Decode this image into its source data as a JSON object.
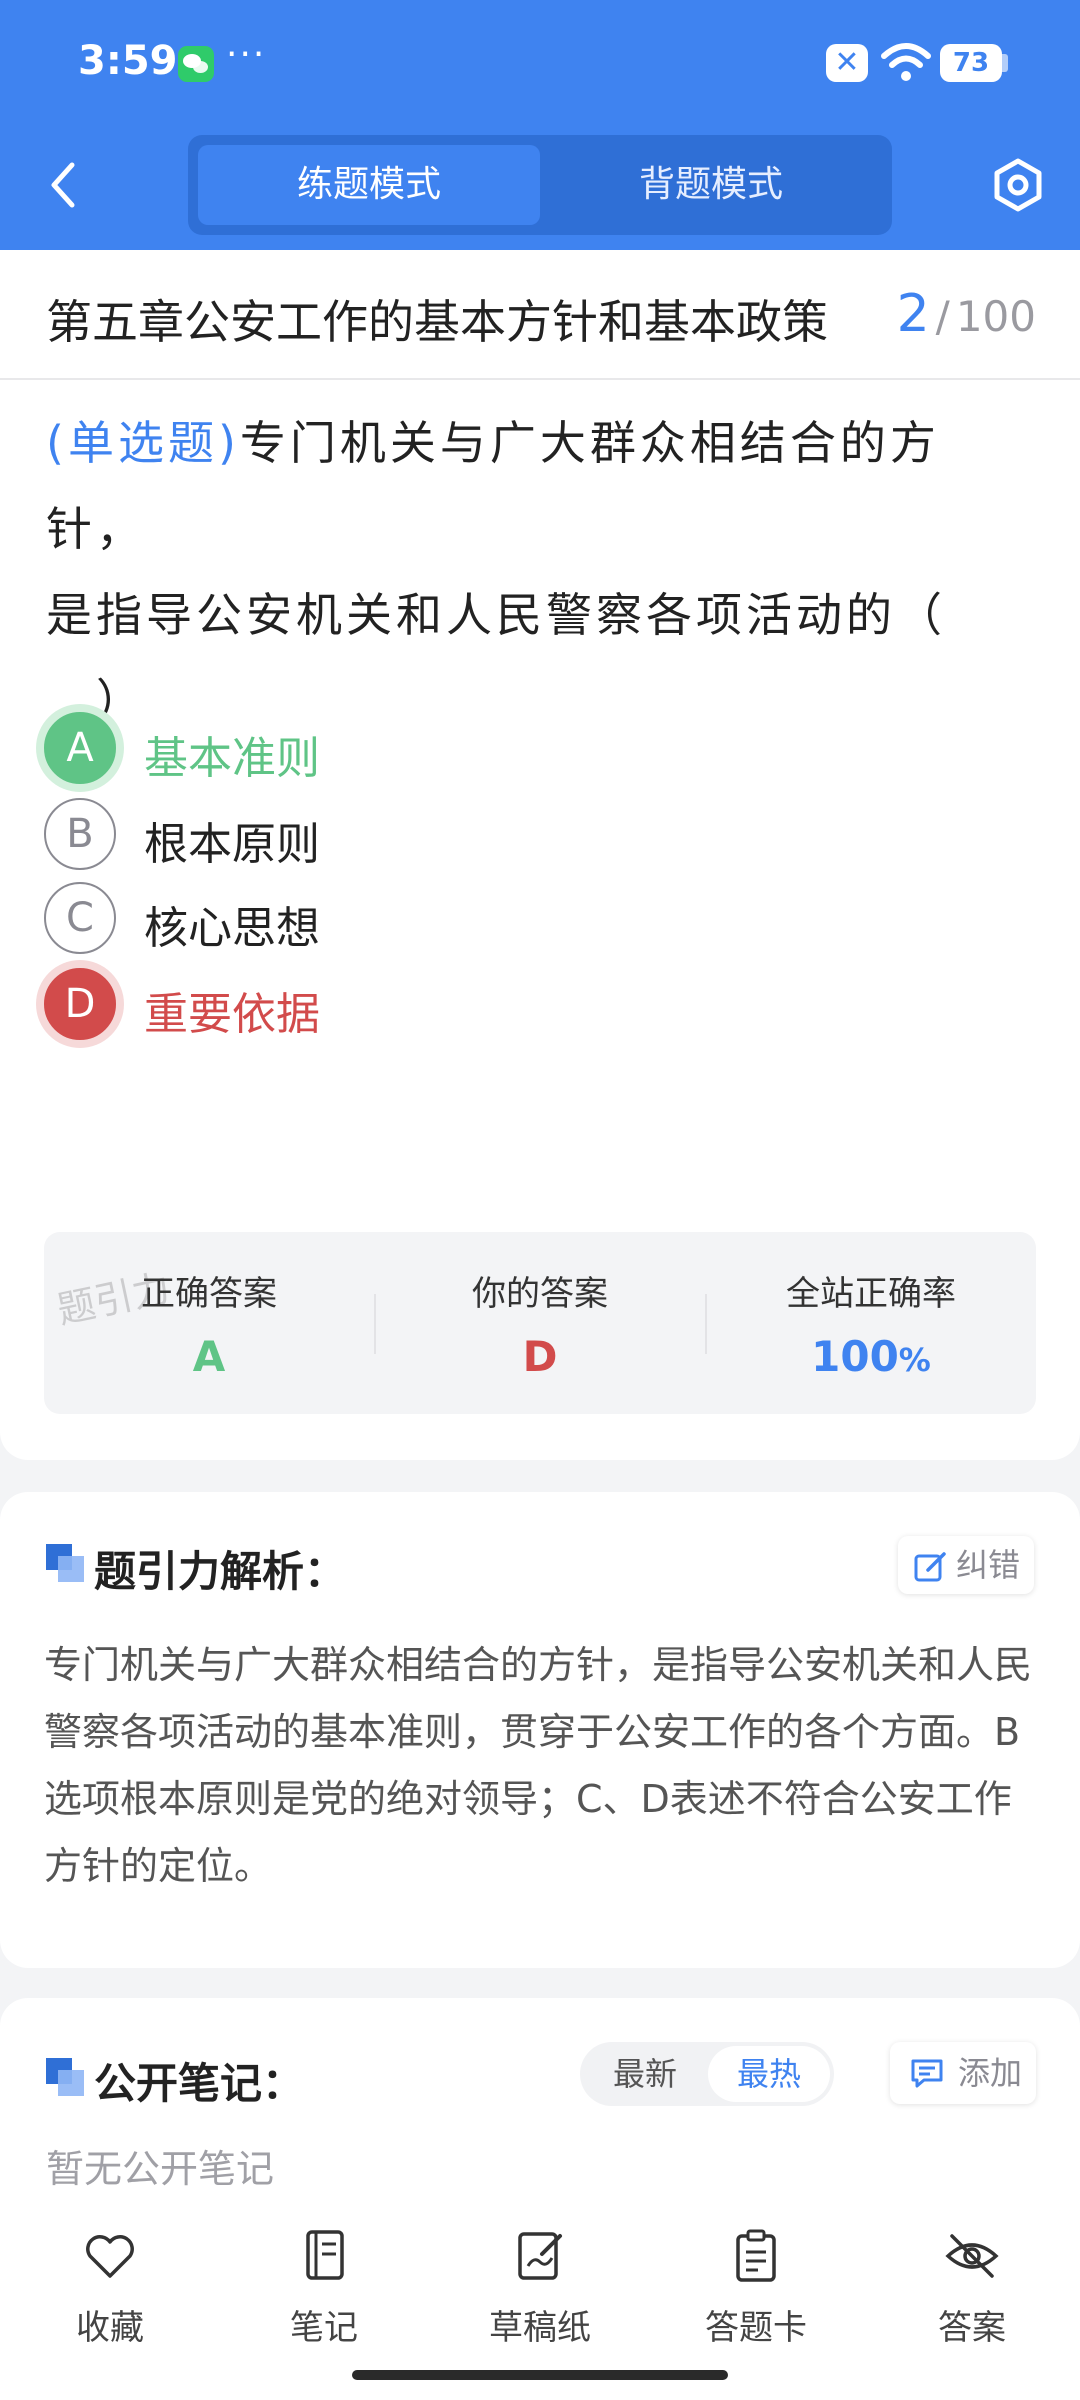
{
  "status_bar": {
    "time": "3:59",
    "dots": "···",
    "battery": "73"
  },
  "header": {
    "mode_tabs": [
      "练题模式",
      "背题模式"
    ],
    "active_tab": "练题模式"
  },
  "chapter": {
    "title": "第五章公安工作的基本方针和基本政策",
    "current": "2",
    "separator": "/",
    "total": "100"
  },
  "question": {
    "type_label": "(单选题)",
    "text_line1": "专门机关与广大群众相结合的方针，",
    "text_line2": "是指导公安机关和人民警察各项活动的（",
    "text_line3": "　）"
  },
  "options": [
    {
      "letter": "A",
      "text": "基本准则",
      "state": "correct"
    },
    {
      "letter": "B",
      "text": "根本原则",
      "state": "normal"
    },
    {
      "letter": "C",
      "text": "核心思想",
      "state": "normal"
    },
    {
      "letter": "D",
      "text": "重要依据",
      "state": "wrong"
    }
  ],
  "answer_summary": {
    "correct_label": "正确答案",
    "correct_value": "A",
    "your_label": "你的答案",
    "your_value": "D",
    "rate_label": "全站正确率",
    "rate_value": "100",
    "rate_unit": "%",
    "watermark": "题引力"
  },
  "analysis": {
    "title": "题引力解析：",
    "report_button": "纠错",
    "text": "专门机关与广大群众相结合的方针，是指导公安机关和人民警察各项活动的基本准则，贯穿于公安工作的各个方面。B选项根本原则是党的绝对领导；C、D表述不符合公安工作方针的定位。"
  },
  "notes": {
    "title": "公开笔记：",
    "sort_newest": "最新",
    "sort_hottest": "最热",
    "active_sort": "最热",
    "add_button": "添加",
    "empty_text": "暂无公开笔记"
  },
  "bottom_nav": [
    {
      "label": "收藏",
      "icon": "heart-icon"
    },
    {
      "label": "笔记",
      "icon": "notebook-icon"
    },
    {
      "label": "草稿纸",
      "icon": "draft-paper-icon"
    },
    {
      "label": "答题卡",
      "icon": "answer-card-icon"
    },
    {
      "label": "答案",
      "icon": "eye-off-icon"
    }
  ],
  "colors": {
    "primary": "#3f83f0",
    "correct": "#5fc486",
    "wrong": "#d24b4b"
  }
}
